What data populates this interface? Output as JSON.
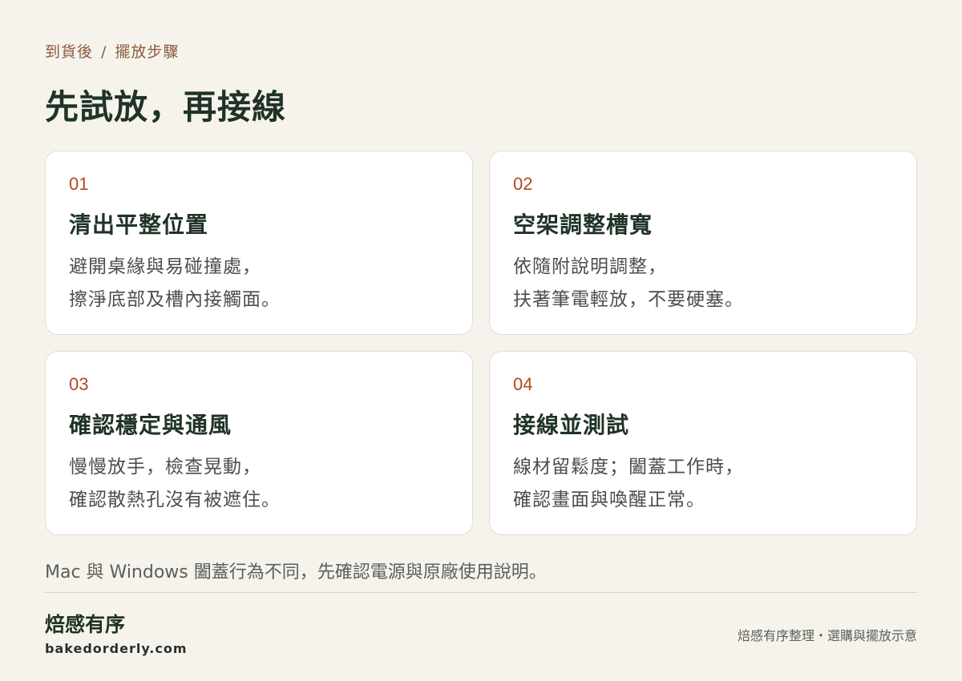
{
  "header": {
    "breadcrumb_parent": "到貨後",
    "breadcrumb_separator": "/",
    "breadcrumb_current": "擺放步驟",
    "title": "先試放，再接線"
  },
  "steps": [
    {
      "num": "01",
      "title": "清出平整位置",
      "line1": "避開桌緣與易碰撞處，",
      "line2": "擦淨底部及槽內接觸面。"
    },
    {
      "num": "02",
      "title": "空架調整槽寬",
      "line1": "依隨附說明調整，",
      "line2": "扶著筆電輕放，不要硬塞。"
    },
    {
      "num": "03",
      "title": "確認穩定與通風",
      "line1": "慢慢放手，檢查晃動，",
      "line2": "確認散熱孔沒有被遮住。"
    },
    {
      "num": "04",
      "title": "接線並測試",
      "line1": "線材留鬆度；闔蓋工作時，",
      "line2": "確認畫面與喚醒正常。"
    }
  ],
  "note": "Mac 與 Windows 闔蓋行為不同，先確認電源與原廠使用說明。",
  "footer": {
    "brand": "焙感有序",
    "site": "bakedorderly.com",
    "credit": "焙感有序整理・選購與擺放示意"
  }
}
